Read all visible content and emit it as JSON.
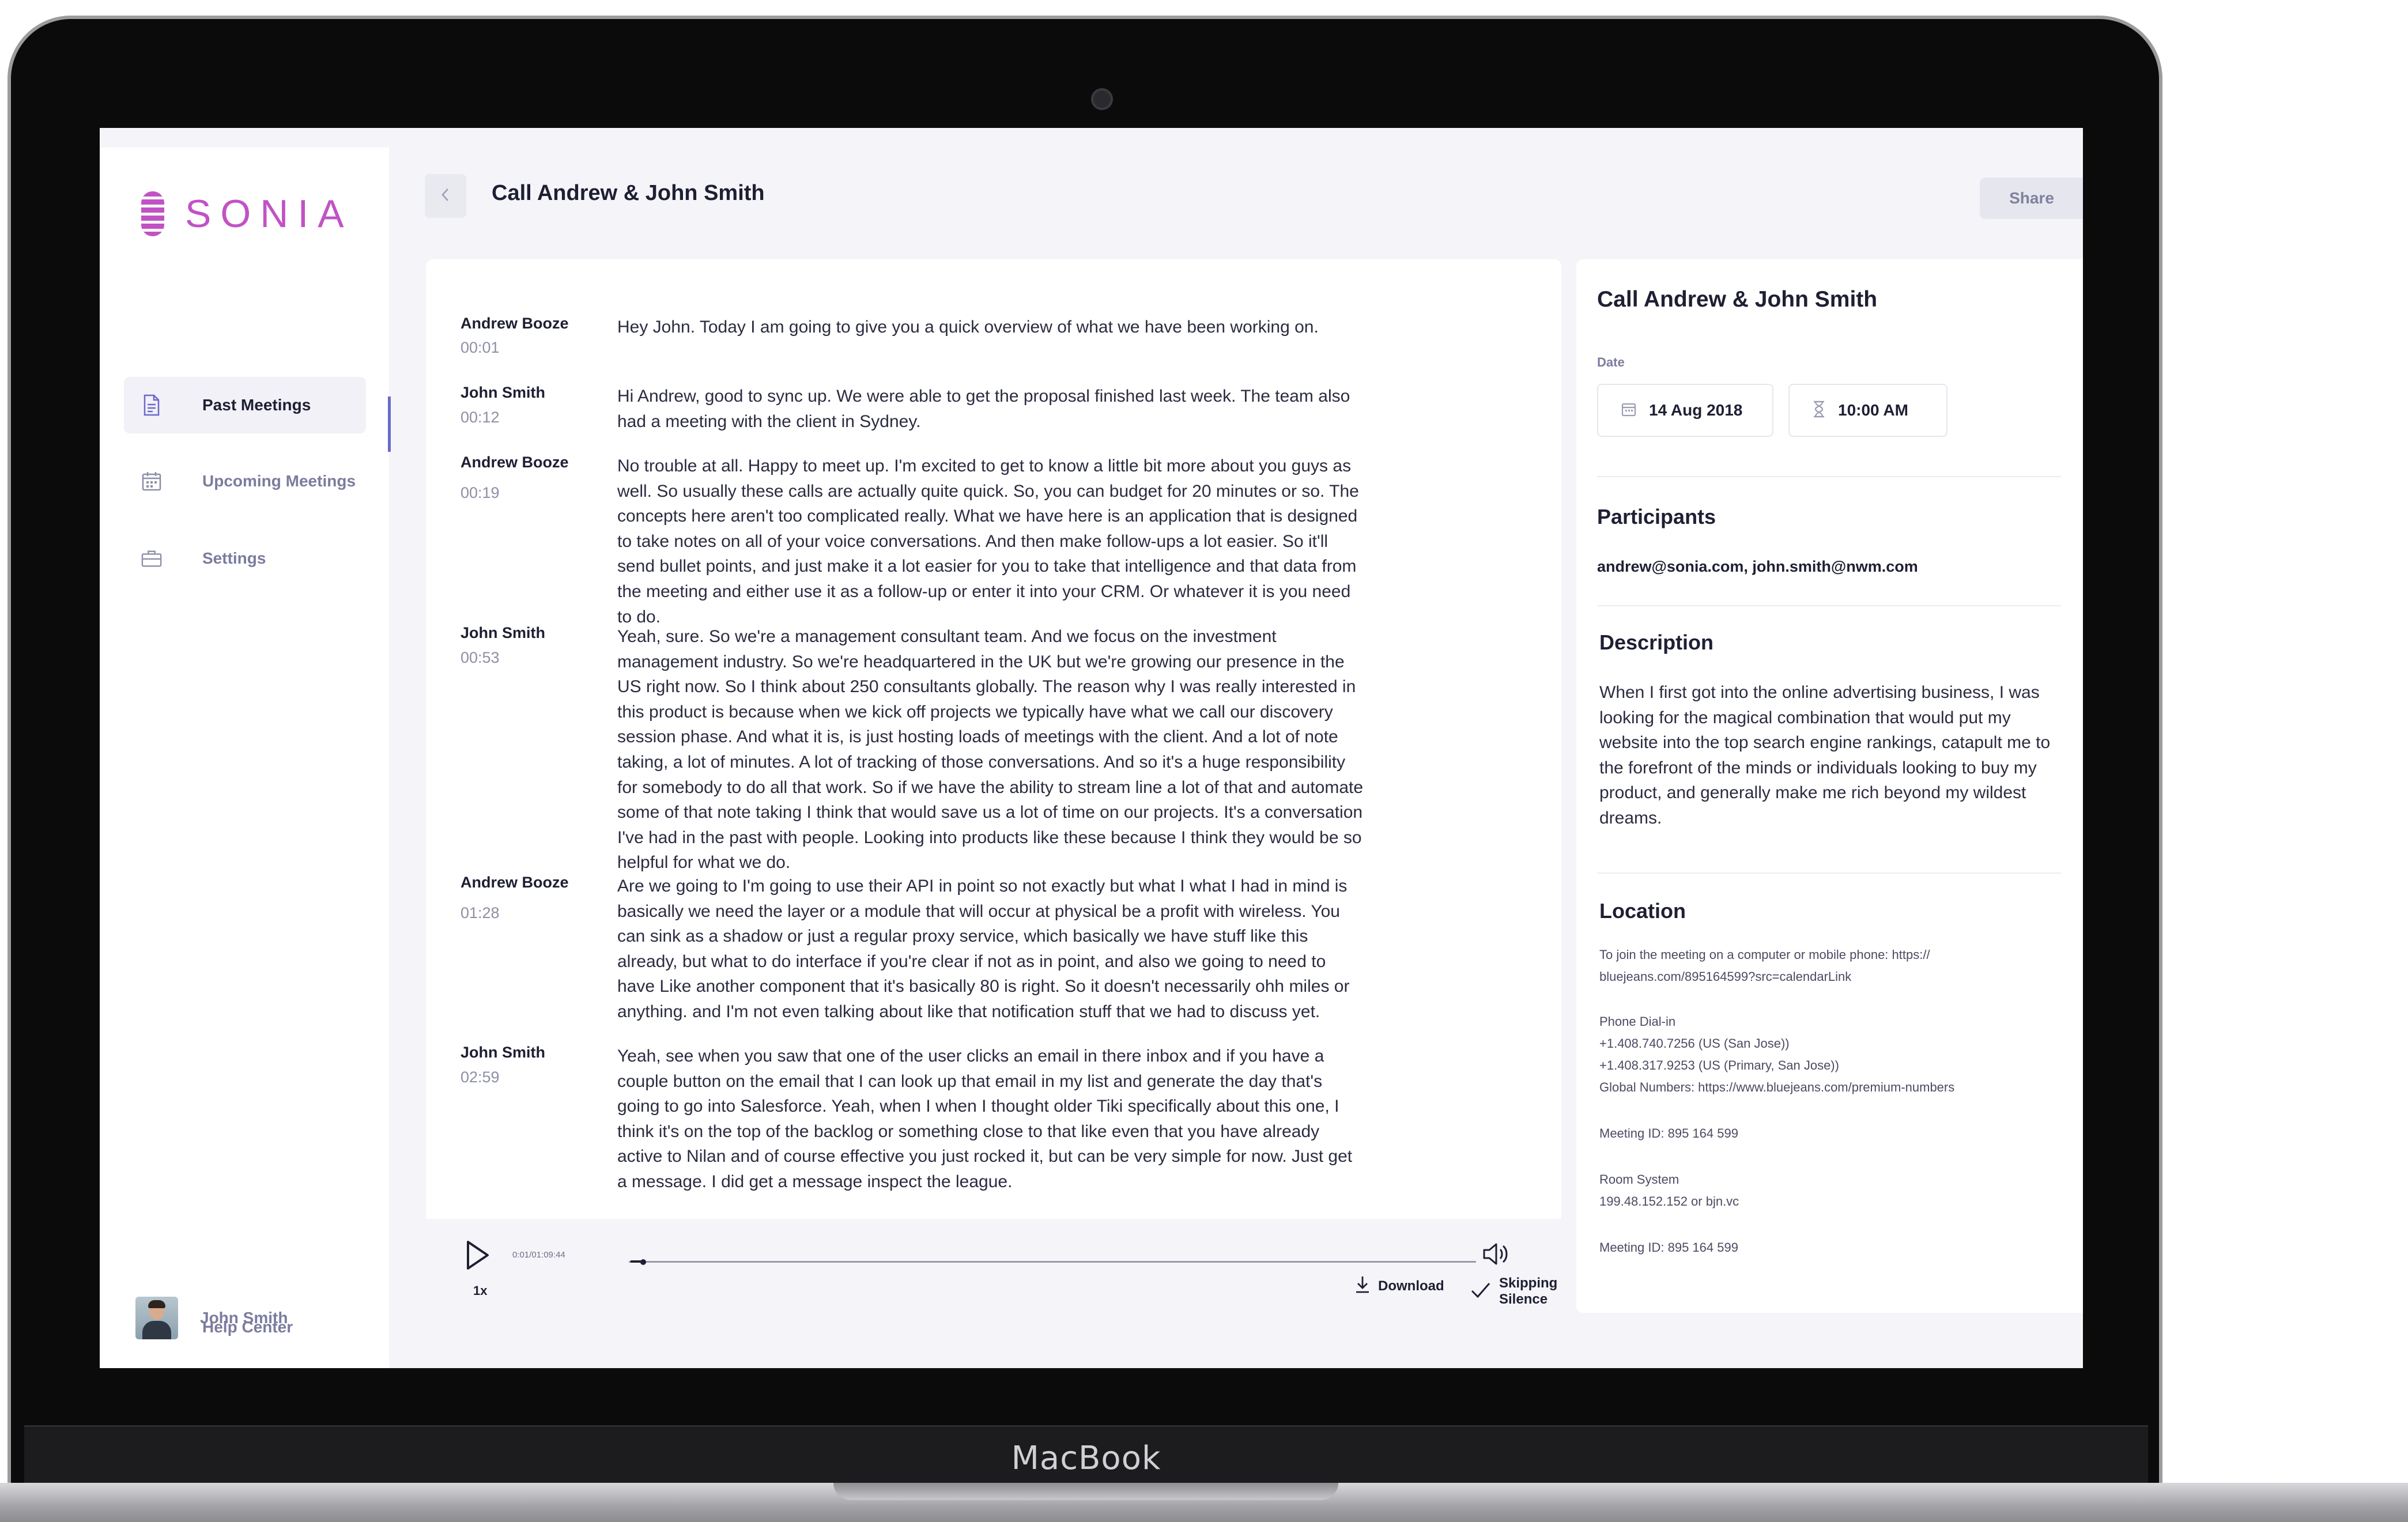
{
  "device": {
    "brand": "MacBook"
  },
  "app": {
    "logo_text": "SONIA",
    "accent_color": "#c152c5",
    "nav_active_color": "#6a69c9"
  },
  "sidebar": {
    "items": [
      {
        "label": "Past Meetings",
        "icon": "document-icon",
        "active": true
      },
      {
        "label": "Upcoming Meetings",
        "icon": "calendar-icon",
        "active": false
      },
      {
        "label": "Settings",
        "icon": "briefcase-icon",
        "active": false
      }
    ],
    "help": {
      "label": "Help Center",
      "icon": "question-icon"
    },
    "user": {
      "name": "John Smith"
    }
  },
  "header": {
    "title": "Call Andrew & John Smith",
    "share_label": "Share"
  },
  "transcript": [
    {
      "speaker": "Andrew Booze",
      "time": "00:01",
      "text": "Hey John. Today I am going to give you a quick overview of what we have been working on."
    },
    {
      "speaker": "John Smith",
      "time": "00:12",
      "text": "Hi Andrew, good to sync up. We were able to get the proposal finished last week. The team also had a meeting with the client in Sydney."
    },
    {
      "speaker": "Andrew Booze",
      "time": "00:19",
      "text": "No trouble at all. Happy to meet up. I'm excited to get to know a little bit more about you guys as well. So usually these calls are actually quite quick. So, you can budget for 20 minutes or so. The concepts here aren't too complicated really. What we have here is an application that is designed to take notes on all of your voice conversations. And then make follow-ups a lot easier. So it'll send bullet points, and just make it a lot easier for you to take that intelligence and that data from the meeting and either use it as a follow-up or enter it into your CRM. Or whatever it is you need to do."
    },
    {
      "speaker": "John Smith",
      "time": "00:53",
      "text": "Yeah, sure. So we're a management consultant team. And we focus on the investment management industry. So we're headquartered in the UK but we're growing our presence in the US right now. So I think about 250 consultants globally. The reason why I was really interested in this product is because when we kick off projects we typically have what we call our discovery session phase. And what it is, is just hosting loads of meetings with the client. And a lot of note taking, a lot of minutes. A lot of tracking of those conversations. And so it's a huge responsibility for somebody to do all that work. So if we have the ability to stream line a lot of that and automate some of that note taking I think that would save us a lot of time on our projects. It's a conversation I've had in the past with people. Looking into products like these because I think they would be so helpful for what we do."
    },
    {
      "speaker": "Andrew Booze",
      "time": "01:28",
      "text": "Are we going to I'm going to use their API in point so not exactly but what I what I had in mind is basically we need the layer or a module that will occur at physical be a profit with wireless. You can sink as a shadow or just a regular proxy service, which basically we have stuff like this already, but what to do interface if you're clear if not as in point, and also we going to need to have Like another component that it's basically 80 is right. So it doesn't necessarily ohh miles or anything. and I'm not even talking about like that notification stuff that we had to discuss yet."
    },
    {
      "speaker": "John Smith",
      "time": "02:59",
      "text": "Yeah, see when you saw that one of the user clicks an email in there inbox and if you have a couple button on the email that I can look up that email in my list and generate the day that's going to go into Salesforce. Yeah, when I when I thought older Tiki specifically about this one, I think it's on the top of the backlog or something close to that like even that you have already active to Nilan and of course effective you just rocked it, but can be very simple for now. Just get a message. I did get a message inspect the league."
    }
  ],
  "player": {
    "time": "0:01/01:09:44",
    "speed": "1x",
    "progress": 0.002,
    "download_label": "Download",
    "skip_label": "Skipping Silence"
  },
  "details": {
    "title": "Call Andrew & John Smith",
    "date_label": "Date",
    "date": "14 Aug 2018",
    "time": "10:00 AM",
    "participants_heading": "Participants",
    "participants": "andrew@sonia.com, john.smith@nwm.com",
    "description_heading": "Description",
    "description": "When I first got into the online advertising business, I was looking for the magical combination that would put my website into the top search engine rankings, catapult me to the forefront of the minds or individuals looking to buy my product, and generally make me rich beyond my wildest dreams.",
    "location_heading": "Location",
    "location": {
      "join_line1": "To join the meeting on a computer or mobile phone: https://",
      "join_line2": "bluejeans.com/895164599?src=calendarLink",
      "dialin_label": "Phone Dial-in",
      "phone1": "+1.408.740.7256 (US (San Jose))",
      "phone2": "+1.408.317.9253 (US (Primary, San Jose))",
      "global": "Global Numbers: https://www.bluejeans.com/premium-numbers",
      "meeting_id_1": "Meeting ID: 895 164 599",
      "room_label": "Room System",
      "room_value": "199.48.152.152 or bjn.vc",
      "meeting_id_2": "Meeting ID: 895 164 599"
    }
  }
}
